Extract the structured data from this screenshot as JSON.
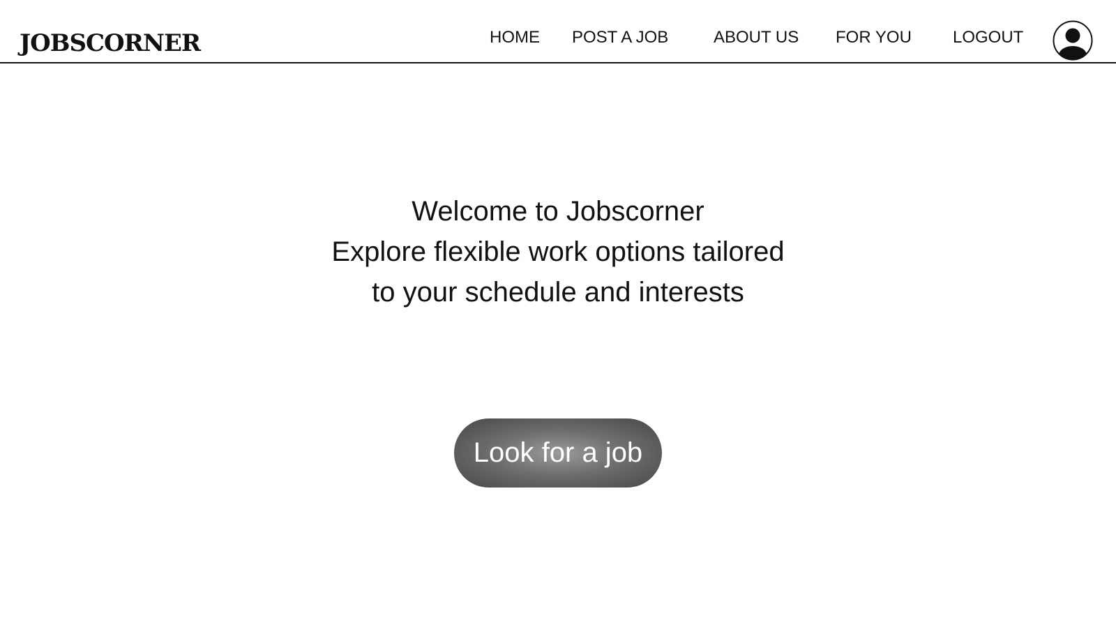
{
  "header": {
    "logo": "JOBSCORNER",
    "nav": {
      "home": "HOME",
      "post_job": "POST A JOB",
      "about": "ABOUT US",
      "for_you": "FOR YOU",
      "logout": "LOGOUT"
    },
    "avatar_icon": "user-circle-icon"
  },
  "hero": {
    "line1": "Welcome to Jobscorner",
    "line2": "Explore flexible work options tailored",
    "line3": "to your schedule and interests"
  },
  "cta": {
    "label": "Look for a job"
  },
  "colors": {
    "text": "#111111",
    "background": "#ffffff",
    "button_center": "#9a9a9a",
    "button_edge": "#474747",
    "button_text": "#ffffff"
  }
}
